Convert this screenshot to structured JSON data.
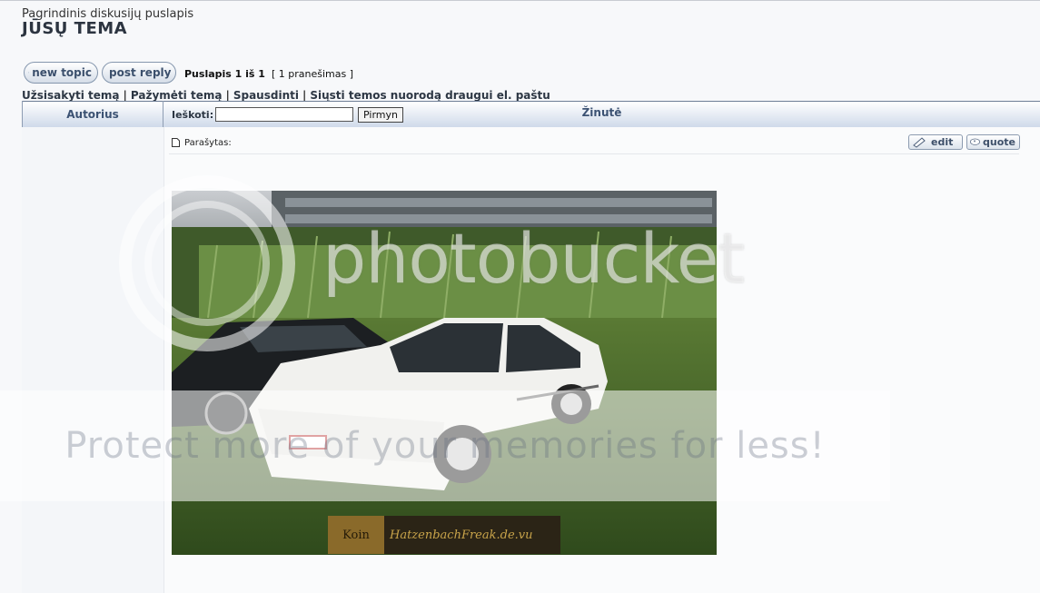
{
  "header": {
    "breadcrumb": "Pagrindinis diskusijų puslapis",
    "title": "JŪSŲ TEMA"
  },
  "buttons": {
    "new_topic": "new topic",
    "post_reply": "post reply",
    "edit": "edit",
    "quote": "quote"
  },
  "pagination": {
    "page_info": "Puslapis 1 iš 1",
    "post_count": "[ 1 pranešimas ]"
  },
  "topic_actions": [
    "Užsisakyti temą",
    "Pažymėti temą",
    "Spausdinti",
    "Siųsti temos nuorodą draugui el. paštu"
  ],
  "table_header": {
    "author": "Autorius",
    "search_label": "Ieškoti:",
    "search_value": "",
    "search_button": "Pirmyn",
    "message": "Žinutė"
  },
  "post": {
    "posted_label": "Parašytas:",
    "photo_subject": "white-coupe-car-photo",
    "signature_logo": "Koin",
    "signature_url": "HatzenbachFreak.de.vu"
  },
  "overlay": {
    "watermark": "photobucket",
    "promo": "Protect more of your memories for less!"
  },
  "colors": {
    "header_text": "#3c5273",
    "link_text": "#2d3744",
    "grass": "#4c6a2e",
    "car": "#f1f1ee"
  }
}
